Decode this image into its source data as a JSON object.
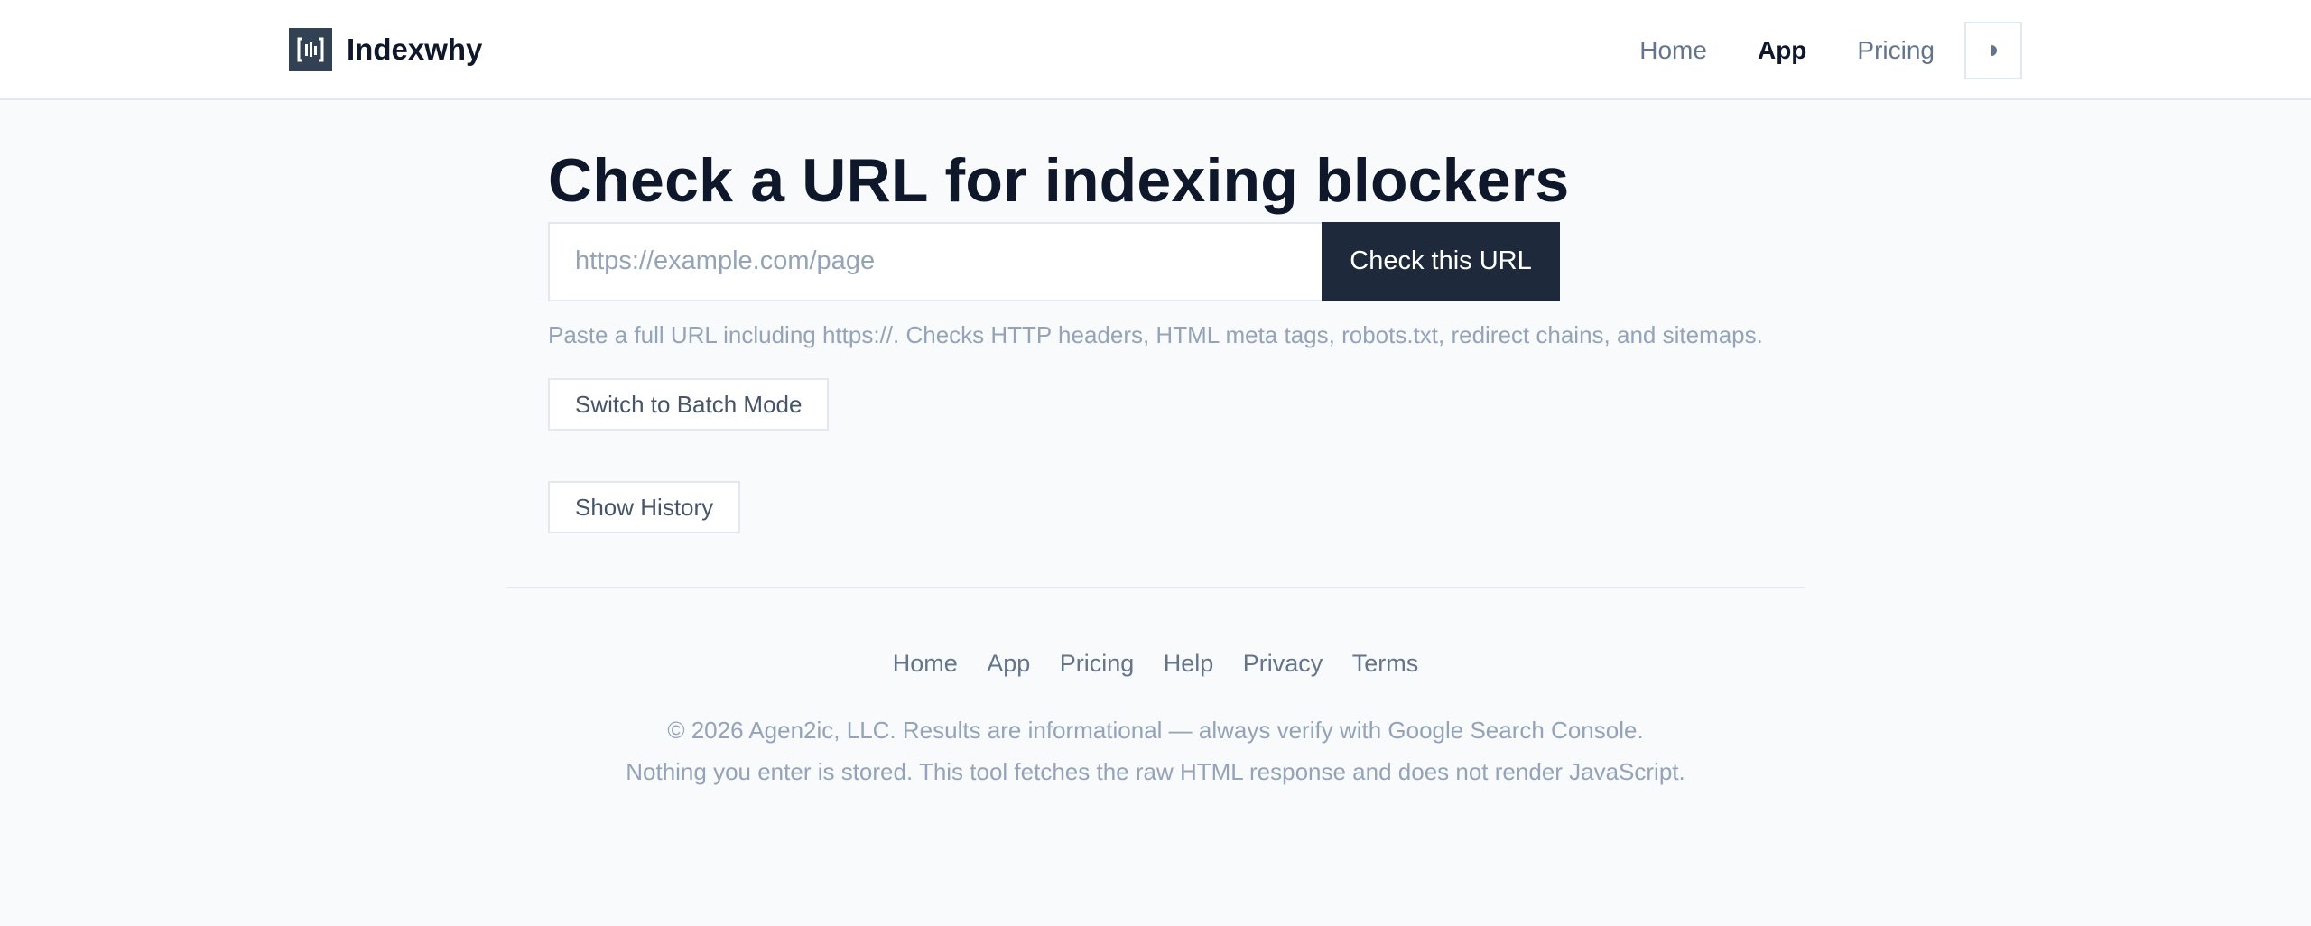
{
  "header": {
    "brand_name": "Indexwhy",
    "logo_icon": "bracket-bars-logo-icon",
    "nav": [
      {
        "label": "Home",
        "active": false
      },
      {
        "label": "App",
        "active": true
      },
      {
        "label": "Pricing",
        "active": false
      }
    ],
    "theme_toggle_icon": "half-circle-icon"
  },
  "main": {
    "title": "Check a URL for indexing blockers",
    "url_placeholder": "https://example.com/page",
    "url_value": "",
    "check_button": "Check this URL",
    "hint": "Paste a full URL including https://. Checks HTTP headers, HTML meta tags, robots.txt, redirect chains, and sitemaps.",
    "batch_button": "Switch to Batch Mode",
    "history_button": "Show History"
  },
  "footer": {
    "links": [
      "Home",
      "App",
      "Pricing",
      "Help",
      "Privacy",
      "Terms"
    ],
    "copyright": "© 2026 Agen2ic, LLC. Results are informational — always verify with Google Search Console.",
    "disclaimer": "Nothing you enter is stored. This tool fetches the raw HTML response and does not render JavaScript."
  },
  "colors": {
    "background": "#f8fafc",
    "primary_button": "#1e293b",
    "logo": "#334155",
    "muted_text": "#94a3b8"
  }
}
